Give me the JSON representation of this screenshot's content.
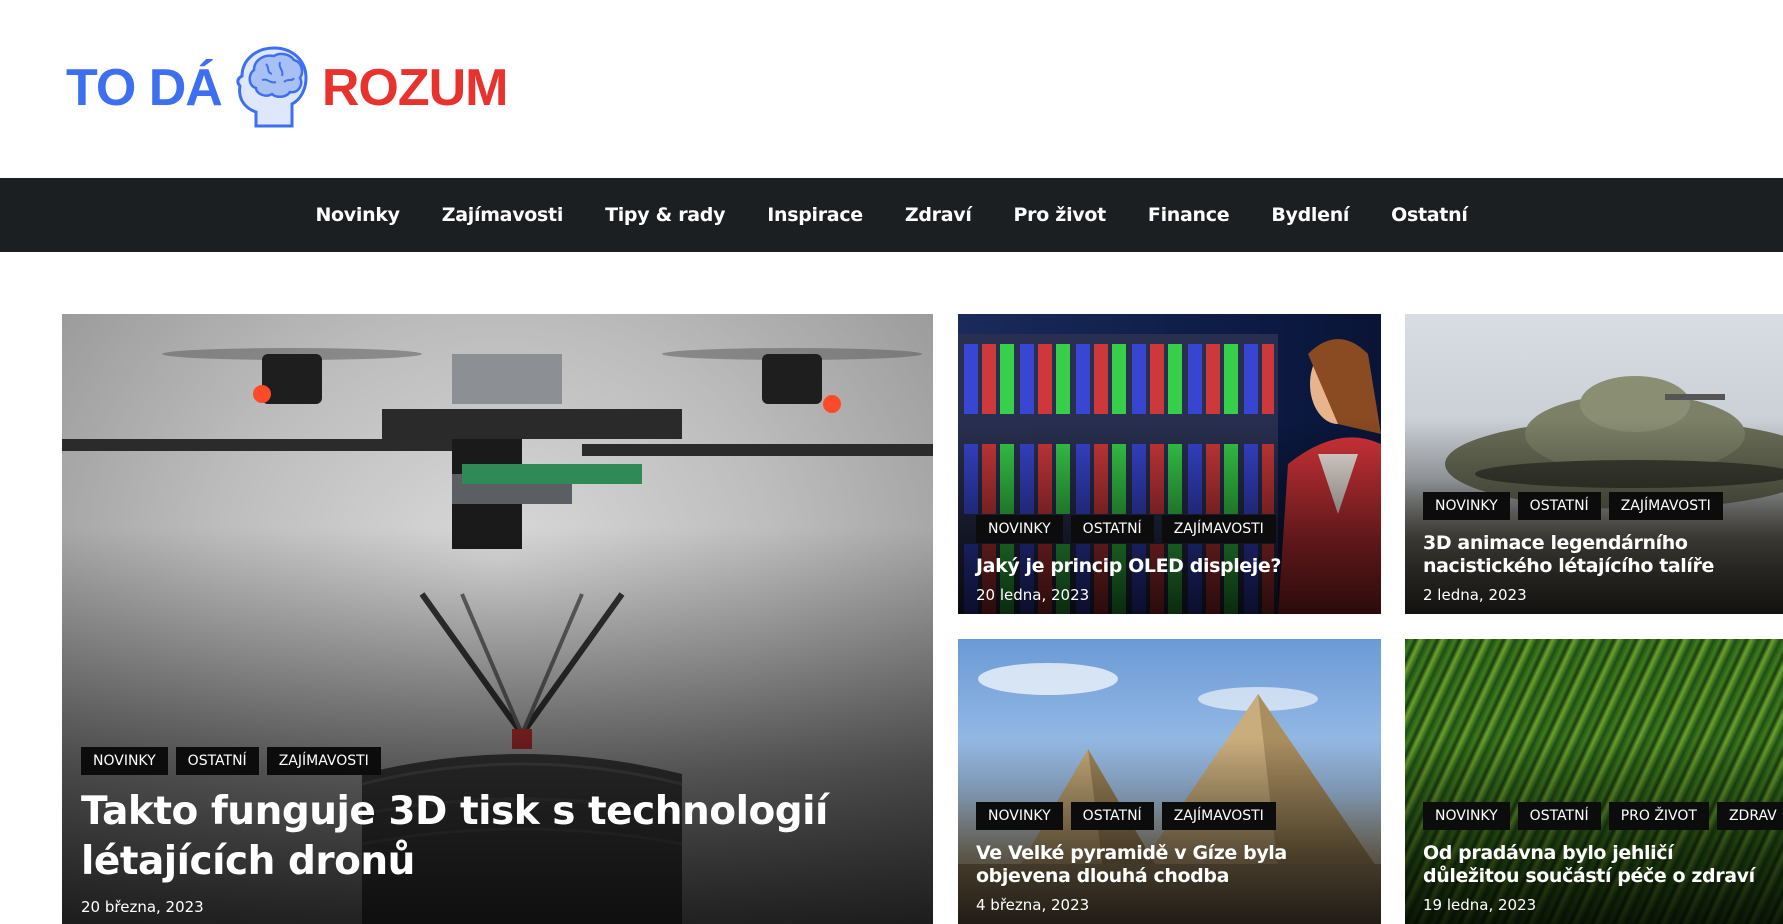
{
  "logo": {
    "part1": "TO DÁ",
    "part2": "ROZUM",
    "icon": "brain-head-icon"
  },
  "nav": {
    "items": [
      "Novinky",
      "Zajímavosti",
      "Tipy & rady",
      "Inspirace",
      "Zdraví",
      "Pro život",
      "Finance",
      "Bydlení",
      "Ostatní"
    ]
  },
  "articles": [
    {
      "tags": [
        "NOVINKY",
        "OSTATNÍ",
        "ZAJÍMAVOSTI"
      ],
      "title": "Takto funguje 3D tisk s technologií létajících dronů",
      "date": "20 března, 2023",
      "image": "drone-3d-printing-photo"
    },
    {
      "tags": [
        "NOVINKY",
        "OSTATNÍ",
        "ZAJÍMAVOSTI"
      ],
      "title": "Jaký je princip OLED displeje?",
      "date": "20 ledna, 2023",
      "image": "oled-subpixels-woman-photo"
    },
    {
      "tags": [
        "NOVINKY",
        "OSTATNÍ",
        "ZAJÍMAVOSTI"
      ],
      "title": "3D animace legendárního nacistického létajícího talíře",
      "date": "2 ledna, 2023",
      "image": "flying-saucer-render"
    },
    {
      "tags": [
        "NOVINKY",
        "OSTATNÍ",
        "ZAJÍMAVOSTI"
      ],
      "title": "Ve Velké pyramidě v Gíze byla objevena dlouhá chodba",
      "date": "4 března, 2023",
      "image": "giza-pyramids-photo"
    },
    {
      "tags": [
        "NOVINKY",
        "OSTATNÍ",
        "PRO ŽIVOT",
        "ZDRAV"
      ],
      "title": "Od pradávna bylo jehličí důležitou součástí péče o zdraví",
      "date": "19 ledna, 2023",
      "image": "pine-needles-photo"
    }
  ],
  "colors": {
    "brand_blue": "#3d6ff0",
    "brand_red": "#e8322d",
    "nav_bg": "#1c1f22",
    "tag_bg": "#0c0c0c"
  }
}
